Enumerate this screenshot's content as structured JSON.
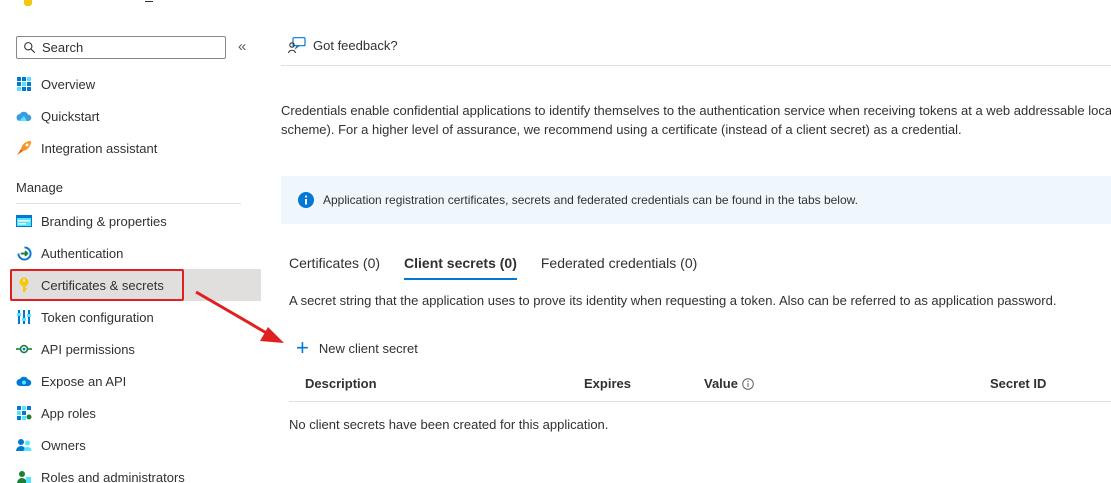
{
  "search": {
    "placeholder": "Search"
  },
  "sidebar": {
    "items": [
      {
        "label": "Overview",
        "icon": "grid-icon"
      },
      {
        "label": "Quickstart",
        "icon": "cloud-icon"
      },
      {
        "label": "Integration assistant",
        "icon": "rocket-icon"
      },
      {
        "label": "Branding & properties",
        "icon": "branding-icon"
      },
      {
        "label": "Authentication",
        "icon": "authentication-icon"
      },
      {
        "label": "Certificates & secrets",
        "icon": "key-icon",
        "selected": true
      },
      {
        "label": "Token configuration",
        "icon": "token-bars-icon"
      },
      {
        "label": "API permissions",
        "icon": "api-permissions-icon"
      },
      {
        "label": "Expose an API",
        "icon": "cloud-api-icon"
      },
      {
        "label": "App roles",
        "icon": "app-roles-grid-icon"
      },
      {
        "label": "Owners",
        "icon": "owners-icon"
      },
      {
        "label": "Roles and administrators",
        "icon": "roles-admin-icon"
      }
    ],
    "section_manage": "Manage"
  },
  "header": {
    "feedback_label": "Got feedback?"
  },
  "main": {
    "description_line1": "Credentials enable confidential applications to identify themselves to the authentication service when receiving tokens at a web addressable locat",
    "description_line2": "scheme). For a higher level of assurance, we recommend using a certificate (instead of a client secret) as a credential.",
    "info_text": "Application registration certificates, secrets and federated credentials can be found in the tabs below.",
    "tabs": [
      {
        "label": "Certificates (0)",
        "active": false
      },
      {
        "label": "Client secrets (0)",
        "active": true
      },
      {
        "label": "Federated credentials (0)",
        "active": false
      }
    ],
    "secret_description": "A secret string that the application uses to prove its identity when requesting a token. Also can be referred to as application password.",
    "new_secret_label": "New client secret",
    "table": {
      "columns": [
        "Description",
        "Expires",
        "Value",
        "Secret ID"
      ],
      "empty_message": "No client secrets have been created for this application."
    }
  },
  "colors": {
    "accent": "#0078d4",
    "highlight_border": "#e02020",
    "selected_bg": "#e1dfdd",
    "info_bg": "#eff6fc"
  }
}
